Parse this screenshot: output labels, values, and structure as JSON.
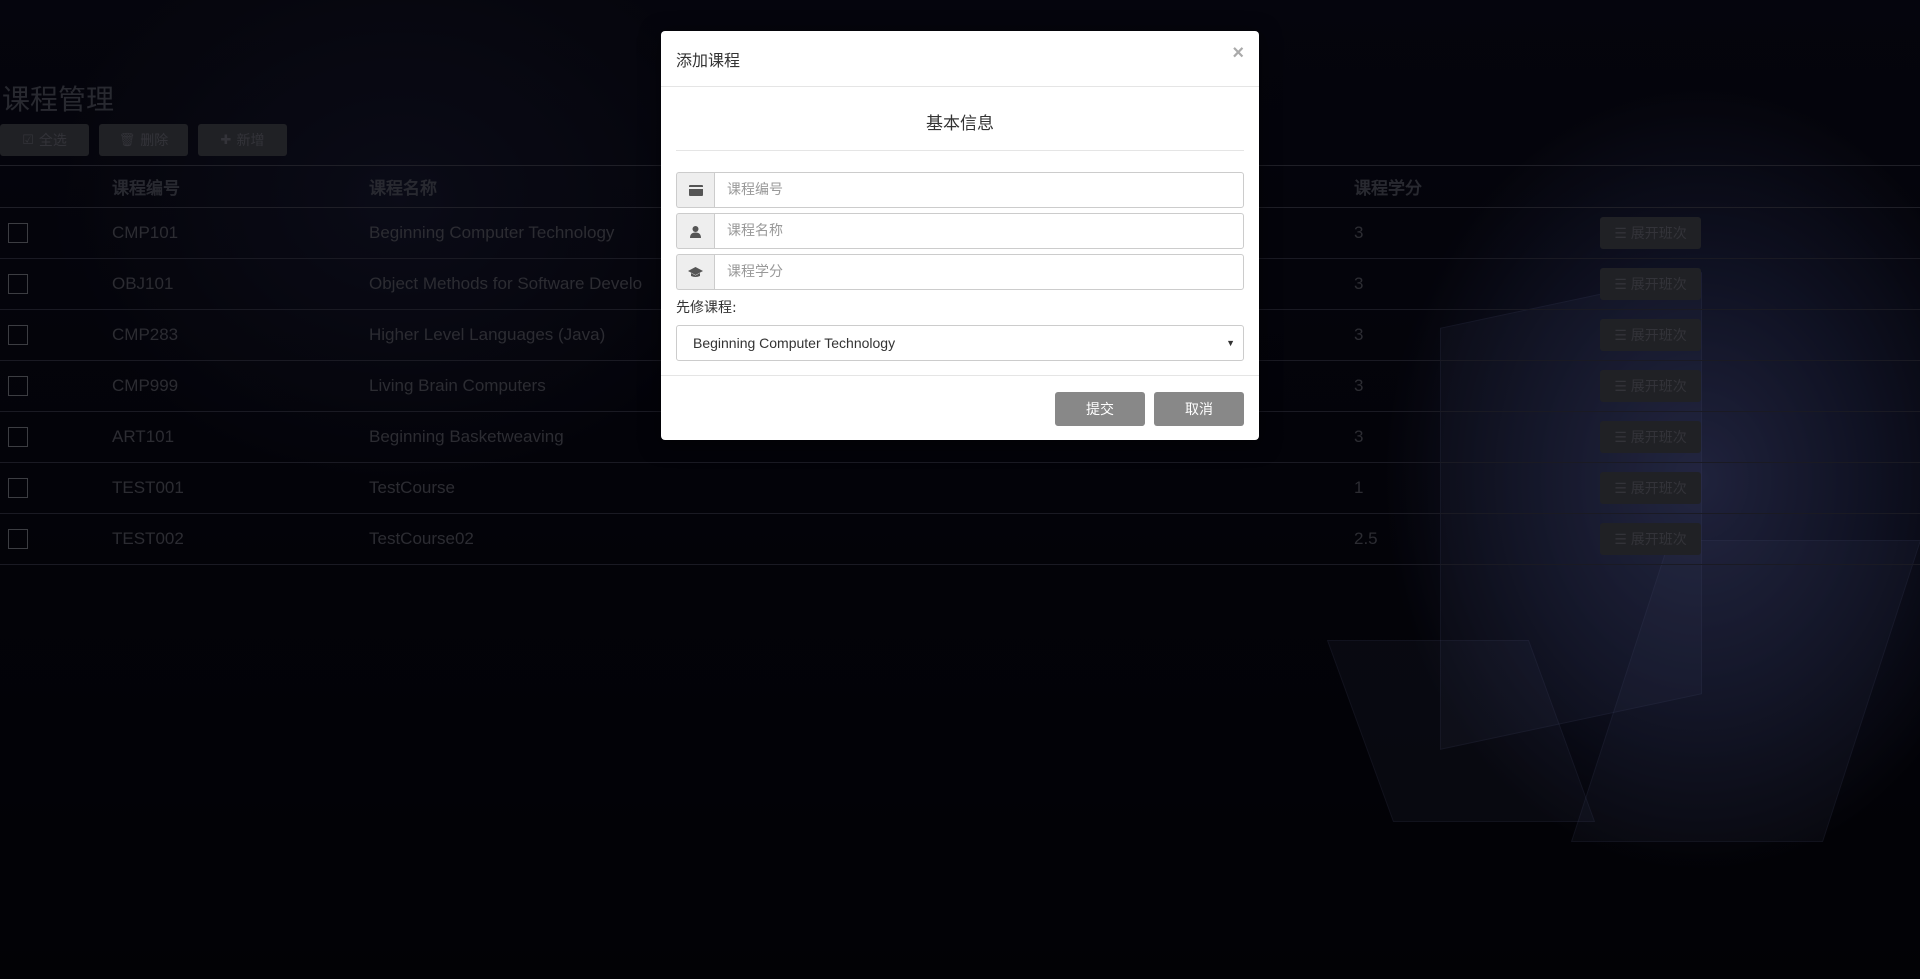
{
  "page": {
    "title": "课程管理"
  },
  "toolbar": {
    "select_all": "全选",
    "delete": "删除",
    "add": "新增"
  },
  "table": {
    "headers": [
      "课程编号",
      "课程名称",
      "课程学分"
    ],
    "rows": [
      {
        "code": "CMP101",
        "name": "Beginning Computer Technology",
        "credits": "3",
        "action": "展开班次"
      },
      {
        "code": "OBJ101",
        "name": "Object Methods for Software Develo",
        "credits": "3",
        "action": "展开班次"
      },
      {
        "code": "CMP283",
        "name": "Higher Level Languages (Java)",
        "credits": "3",
        "action": "展开班次"
      },
      {
        "code": "CMP999",
        "name": "Living Brain Computers",
        "credits": "3",
        "action": "展开班次"
      },
      {
        "code": "ART101",
        "name": "Beginning Basketweaving",
        "credits": "3",
        "action": "展开班次"
      },
      {
        "code": "TEST001",
        "name": "TestCourse",
        "credits": "1",
        "action": "展开班次"
      },
      {
        "code": "TEST002",
        "name": "TestCourse02",
        "credits": "2.5",
        "action": "展开班次"
      }
    ]
  },
  "modal": {
    "title": "添加课程",
    "close": "×",
    "section_title": "基本信息",
    "fields": {
      "code_placeholder": "课程编号",
      "name_placeholder": "课程名称",
      "credits_placeholder": "课程学分"
    },
    "prereq_label": "先修课程:",
    "prereq_selected": "Beginning Computer Technology",
    "submit": "提交",
    "cancel": "取消"
  },
  "colors": {
    "link": "#1e3a66",
    "modal_button": "#888888"
  },
  "icons": [
    "check-square-icon",
    "trash-icon",
    "plus-icon",
    "list-icon",
    "card-icon",
    "user-icon",
    "graduation-cap-icon",
    "chevron-down-icon",
    "close-icon"
  ]
}
